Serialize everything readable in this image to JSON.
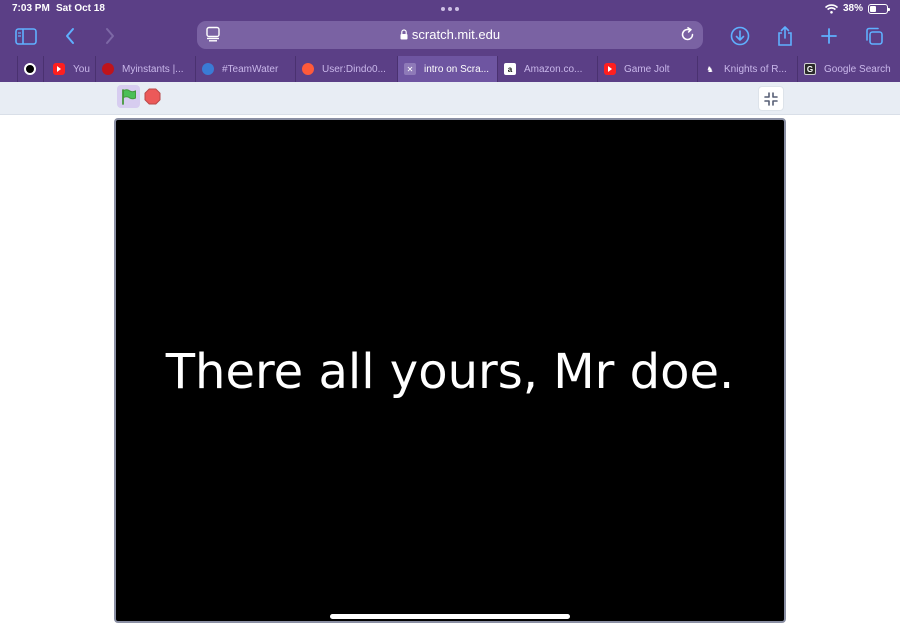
{
  "status": {
    "time": "7:03 PM",
    "date": "Sat Oct 18",
    "battery": "38%",
    "battery_level": 0.38
  },
  "toolbar": {
    "address": "scratch.mit.edu",
    "icons": [
      "sidebar-icon",
      "back-icon",
      "forward-icon",
      "reader-icon",
      "lock-icon",
      "reload-icon",
      "download-icon",
      "share-icon",
      "plus-icon",
      "tabs-icon"
    ]
  },
  "tabs": [
    {
      "label": "",
      "icon": "circle-icon"
    },
    {
      "label": "You",
      "icon": "youtube-icon"
    },
    {
      "label": "Myinstants |...",
      "icon": "myinstants-icon"
    },
    {
      "label": "#TeamWater",
      "icon": "water-drop-icon"
    },
    {
      "label": "User:Dindo0...",
      "icon": "fire-icon"
    },
    {
      "label": "intro on Scra...",
      "icon": "scratch-icon"
    },
    {
      "label": "Amazon.co...",
      "icon": "amazon-icon"
    },
    {
      "label": "Game Jolt",
      "icon": "youtube-icon"
    },
    {
      "label": "Knights of R...",
      "icon": "knights-icon"
    },
    {
      "label": "Google Search",
      "icon": "google-icon"
    }
  ],
  "player": {
    "stage_text": "There all yours, Mr doe.",
    "buttons": [
      "green-flag-icon",
      "stop-sign-icon",
      "shrink-icon"
    ]
  },
  "colors": {
    "browser_chrome": "#5b3f86",
    "address_bar": "#7a62a3",
    "active_tab": "#6e55a1",
    "stage_background": "#000000",
    "stage_text": "#ffffff",
    "green_flag": "#4cbf56",
    "stop_sign": "#ec5959"
  }
}
